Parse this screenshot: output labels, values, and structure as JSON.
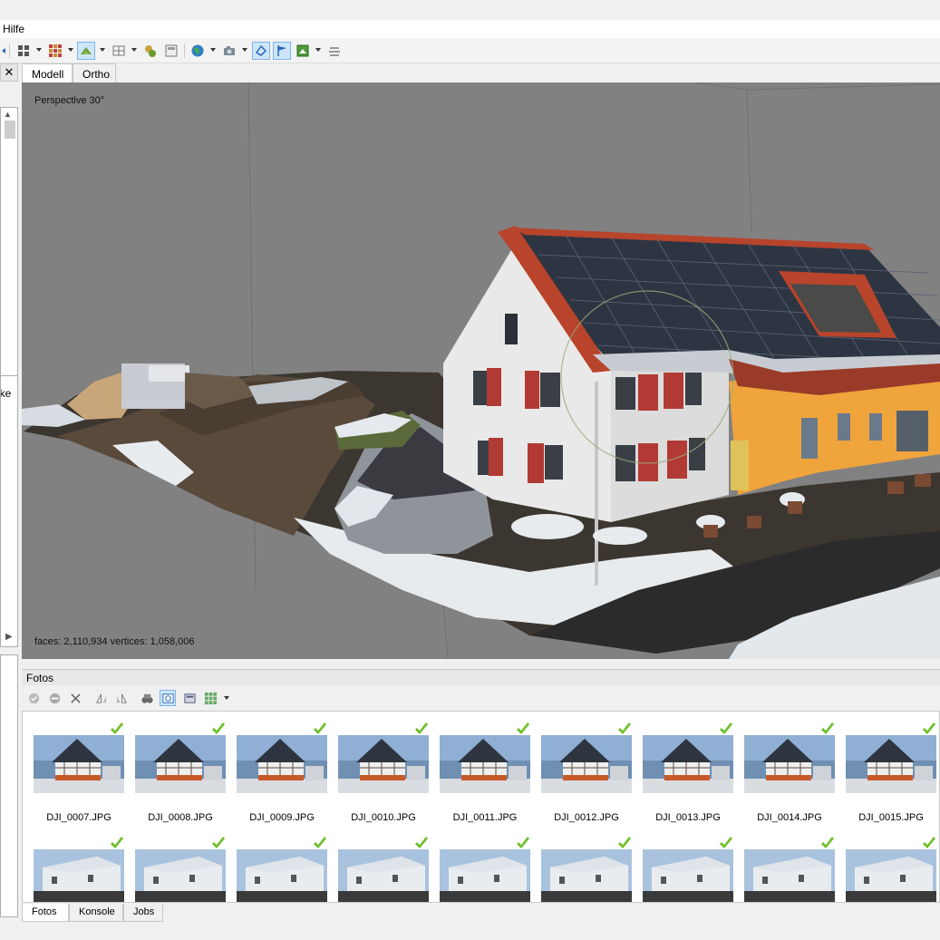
{
  "menubar": {
    "last_menu": "Hilfe"
  },
  "toolbar": {
    "icons": [
      "select-icon",
      "grid-icon",
      "tiles-icon",
      "model-icon",
      "mesh-icon",
      "points-icon",
      "texture-icon",
      "globe-icon",
      "camera-icon",
      "shape-icon",
      "flag-icon",
      "image-icon",
      "layers-icon"
    ]
  },
  "left": {
    "close_label": "✕",
    "props_label_fragment": "gke"
  },
  "view_tabs": [
    {
      "label": "Modell",
      "active": true
    },
    {
      "label": "Ortho",
      "active": false
    }
  ],
  "viewport": {
    "label": "Perspective 30°",
    "stats": "faces: 2,110,934 vertices: 1,058,006"
  },
  "photos": {
    "title": "Fotos",
    "row1": [
      "DJI_0007.JPG",
      "DJI_0008.JPG",
      "DJI_0009.JPG",
      "DJI_0010.JPG",
      "DJI_0011.JPG",
      "DJI_0012.JPG",
      "DJI_0013.JPG",
      "DJI_0014.JPG",
      "DJI_0015.JPG"
    ],
    "row2_count": 9
  },
  "bottom_tabs": [
    {
      "label": "Fotos",
      "active": true
    },
    {
      "label": "Konsole",
      "active": false
    },
    {
      "label": "Jobs",
      "active": false
    }
  ],
  "colors": {
    "accent": "#7eb4ea",
    "check": "#6fbf2a",
    "roof": "#b8442b",
    "wall": "#e9e9e9",
    "viewport_bg": "#818181"
  }
}
